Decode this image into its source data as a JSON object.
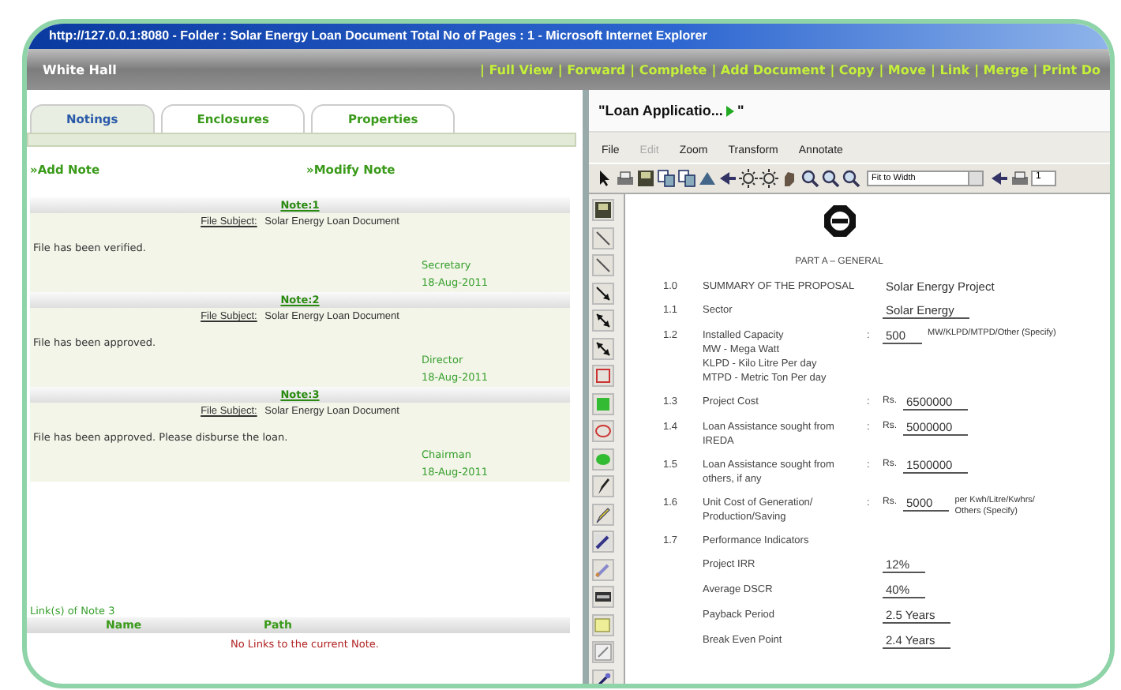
{
  "window": {
    "title": "http://127.0.0.1:8080 - Folder : Solar Energy Loan Document Total No of Pages : 1 - Microsoft Internet Explorer"
  },
  "header": {
    "title": "White Hall",
    "links": [
      "| Full View",
      "| Forward",
      "| Complete",
      "| Add Document",
      "| Copy",
      "| Move",
      "| Link",
      "| Merge",
      "| Print Do"
    ]
  },
  "tabs": [
    {
      "label": "Notings",
      "selected": true
    },
    {
      "label": "Enclosures",
      "selected": false
    },
    {
      "label": "Properties",
      "selected": false
    }
  ],
  "actions": [
    "»Add Note",
    "»Modify Note"
  ],
  "notes": [
    {
      "title": "Note:1",
      "subject_label": "File Subject:",
      "subject": "Solar Energy Loan Document",
      "text": "File has been verified.",
      "author": "Secretary",
      "date": "18-Aug-2011"
    },
    {
      "title": "Note:2",
      "subject_label": "File Subject:",
      "subject": "Solar Energy Loan Document",
      "text": "File has been approved.",
      "author": "Director",
      "date": "18-Aug-2011"
    },
    {
      "title": "Note:3",
      "subject_label": "File Subject:",
      "subject": "Solar Energy Loan Document",
      "text": "File has been approved. Please disburse the loan.",
      "author": "Chairman",
      "date": "18-Aug-2011"
    }
  ],
  "links": {
    "caption": "Link(s) of Note 3",
    "columns": [
      "Name",
      "Path"
    ],
    "empty": "No Links to the current Note."
  },
  "viewer": {
    "title": "\"Loan Applicatio...",
    "title_end": "\"",
    "menu": [
      {
        "label": "File",
        "disabled": false
      },
      {
        "label": "Edit",
        "disabled": true
      },
      {
        "label": "Zoom",
        "disabled": false
      },
      {
        "label": "Transform",
        "disabled": false
      },
      {
        "label": "Annotate",
        "disabled": false
      }
    ],
    "zoom_select": "Fit to Width",
    "page": "1"
  },
  "document": {
    "heading": "PART A – GENERAL",
    "rows": [
      {
        "num": "1.0",
        "label": [
          "SUMMARY OF THE PROPOSAL"
        ],
        "value": "Solar Energy Project",
        "underlined": false
      },
      {
        "num": "1.1",
        "label": [
          "Sector"
        ],
        "value": "Solar Energy",
        "underlined": true
      },
      {
        "num": "1.2",
        "label": [
          "Installed Capacity",
          "MW  -  Mega Watt",
          "KLPD - Kilo Litre Per day",
          "MTPD - Metric Ton Per day"
        ],
        "colon": ":",
        "value": "500",
        "underlined": true,
        "suffix": [
          "MW/KLPD/MTPD/Other (Specify)"
        ]
      },
      {
        "num": "1.3",
        "label": [
          "Project Cost"
        ],
        "colon": ":",
        "prefix": "Rs.",
        "value": "6500000",
        "underlined": true
      },
      {
        "num": "1.4",
        "label": [
          "Loan Assistance sought from",
          "IREDA"
        ],
        "colon": ":",
        "prefix": "Rs.",
        "value": "5000000",
        "underlined": true
      },
      {
        "num": "1.5",
        "label": [
          "Loan Assistance sought from",
          "others, if any"
        ],
        "colon": ":",
        "prefix": "Rs.",
        "value": "1500000",
        "underlined": true
      },
      {
        "num": "1.6",
        "label": [
          "Unit Cost of Generation/",
          "Production/Saving"
        ],
        "colon": ":",
        "prefix": "Rs.",
        "value": "5000",
        "underlined": true,
        "suffix": [
          "per Kwh/Litre/Kwhrs/",
          "Others (Specify)"
        ]
      },
      {
        "num": "1.7",
        "label": [
          "Performance Indicators"
        ]
      },
      {
        "label": [
          "Project IRR"
        ],
        "value": "12%",
        "underlined": true
      },
      {
        "label": [
          "Average DSCR"
        ],
        "value": "40%",
        "underlined": true
      },
      {
        "label": [
          "Payback Period"
        ],
        "value": "2.5 Years",
        "underlined": true
      },
      {
        "label": [
          "Break Even Point"
        ],
        "value": "2.4 Years",
        "underlined": true
      }
    ]
  }
}
